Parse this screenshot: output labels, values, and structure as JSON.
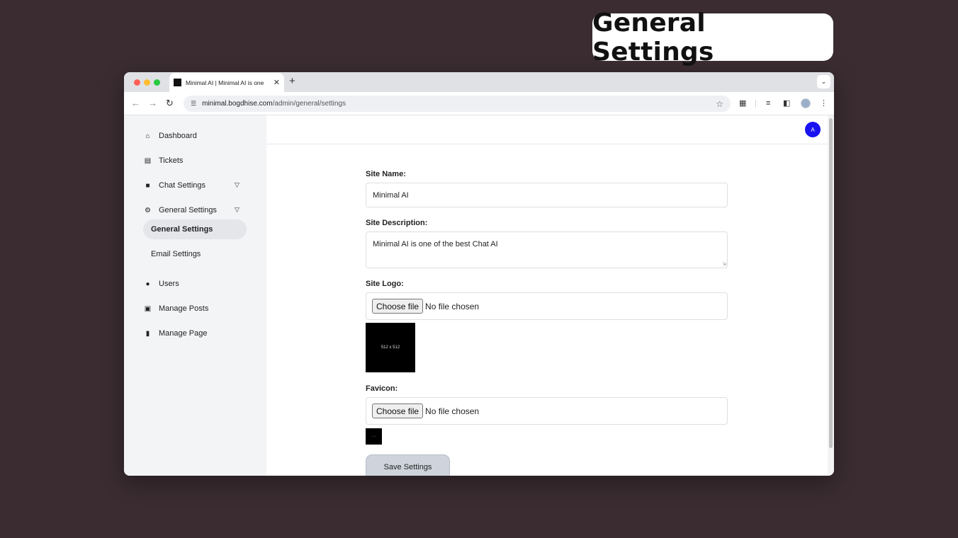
{
  "overlay": {
    "title": "General Settings"
  },
  "browser": {
    "tab_title": "Minimal AI | Minimal AI is one of the best Chat AI",
    "url_host": "minimal.bogdhise.com",
    "url_path": "/admin/general/settings",
    "new_tab": "+",
    "close": "✕",
    "tab_menu": "⌄"
  },
  "sidebar": {
    "items": [
      {
        "label": "Dashboard",
        "icon": "home-icon"
      },
      {
        "label": "Tickets",
        "icon": "ticket-icon"
      },
      {
        "label": "Chat Settings",
        "icon": "chat-icon"
      },
      {
        "label": "General Settings",
        "icon": "gear-icon"
      },
      {
        "label": "Users",
        "icon": "users-icon"
      },
      {
        "label": "Manage Posts",
        "icon": "posts-icon"
      },
      {
        "label": "Manage Page",
        "icon": "page-icon"
      }
    ],
    "submenu": [
      {
        "label": "General Settings",
        "active": true
      },
      {
        "label": "Email Settings",
        "active": false
      }
    ]
  },
  "header": {
    "avatar_initial": "A"
  },
  "form": {
    "site_name_label": "Site Name:",
    "site_name_value": "Minimal AI",
    "site_description_label": "Site Description:",
    "site_description_value": "Minimal AI is one of the best Chat AI",
    "site_logo_label": "Site Logo:",
    "logo_choose": "Choose file",
    "logo_status": "No file chosen",
    "logo_preview_text": "512 x 512",
    "favicon_label": "Favicon:",
    "favicon_choose": "Choose file",
    "favicon_status": "No file chosen",
    "favicon_preview_text": "32 x 32",
    "save_label": "Save Settings"
  },
  "colors": {
    "background": "#3a2c31",
    "avatar": "#1a12f0",
    "save_button": "#cfd4dc",
    "sidebar": "#f3f4f6"
  }
}
